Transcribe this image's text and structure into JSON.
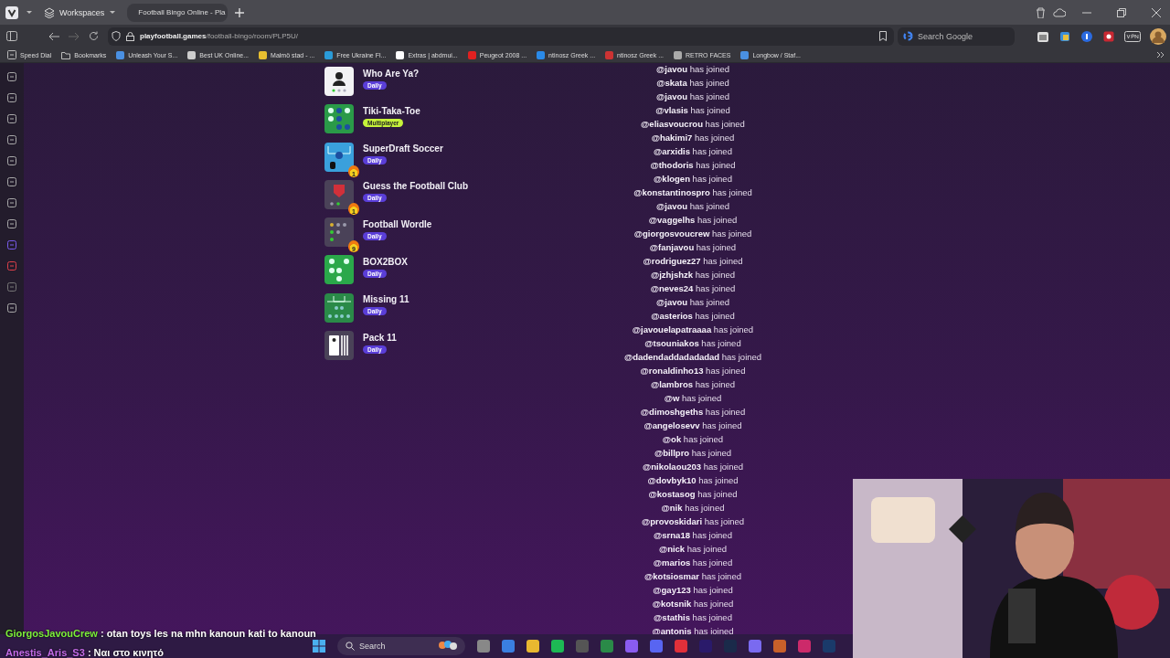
{
  "browser": {
    "workspaces": {
      "label": "Workspaces"
    },
    "tabs": [
      {
        "label": "Football Bingo Online - Pla",
        "selected": true
      }
    ],
    "url": {
      "host": "playfootball.games",
      "path": "/football-bingo/room/PLP5U/"
    },
    "search": {
      "placeholder": "Search Google"
    },
    "bookmarks": [
      {
        "label": "Speed Dial",
        "kind": "dial"
      },
      {
        "label": "Bookmarks",
        "kind": "folder"
      },
      {
        "label": "Unleash Your S...",
        "kind": "site"
      },
      {
        "label": "Best UK Online...",
        "kind": "site"
      },
      {
        "label": "Malmö stad - ...",
        "kind": "site"
      },
      {
        "label": "Free Ukraine Fl...",
        "kind": "site"
      },
      {
        "label": "Extras | abdmui...",
        "kind": "site"
      },
      {
        "label": "Peugeot 2008 ...",
        "kind": "site"
      },
      {
        "label": "ntinosz Greek ...",
        "kind": "site"
      },
      {
        "label": "ntinosz Greek ...",
        "kind": "site"
      },
      {
        "label": "RETRO FACES",
        "kind": "site"
      },
      {
        "label": "Longbow / Staf...",
        "kind": "site"
      }
    ]
  },
  "games": [
    {
      "title": "Who Are Ya?",
      "badge": {
        "label": "Daily",
        "kind": "daily"
      },
      "kind": "player"
    },
    {
      "title": "Tiki-Taka-Toe",
      "badge": {
        "label": "Multiplayer",
        "kind": "multiplayer"
      },
      "kind": "grid"
    },
    {
      "title": "SuperDraft Soccer",
      "badge": {
        "label": "Daily",
        "kind": "daily"
      },
      "kind": "pitch",
      "streak": "1"
    },
    {
      "title": "Guess the Football Club",
      "badge": {
        "label": "Daily",
        "kind": "daily"
      },
      "kind": "crest",
      "streak": "1"
    },
    {
      "title": "Football Wordle",
      "badge": {
        "label": "Daily",
        "kind": "daily"
      },
      "kind": "dots",
      "streak": "9"
    },
    {
      "title": "BOX2BOX",
      "badge": {
        "label": "Daily",
        "kind": "daily"
      },
      "kind": "dice"
    },
    {
      "title": "Missing 11",
      "badge": {
        "label": "Daily",
        "kind": "daily"
      },
      "kind": "lineup"
    },
    {
      "title": "Pack 11",
      "badge": {
        "label": "Daily",
        "kind": "daily"
      },
      "kind": "pack"
    }
  ],
  "joined": [
    {
      "user": "@javou",
      "text": "has joined"
    },
    {
      "user": "@skata",
      "text": "has joined"
    },
    {
      "user": "@javou",
      "text": "has joined"
    },
    {
      "user": "@vlasis",
      "text": "has joined"
    },
    {
      "user": "@eliasvoucrou",
      "text": "has joined"
    },
    {
      "user": "@hakimi7",
      "text": "has joined"
    },
    {
      "user": "@arxidis",
      "text": "has joined"
    },
    {
      "user": "@thodoris",
      "text": "has joined"
    },
    {
      "user": "@klogen",
      "text": "has joined"
    },
    {
      "user": "@konstantinospro",
      "text": "has joined"
    },
    {
      "user": "@javou",
      "text": "has joined"
    },
    {
      "user": "@vaggelhs",
      "text": "has joined"
    },
    {
      "user": "@giorgosvoucrew",
      "text": "has joined"
    },
    {
      "user": "@fanjavou",
      "text": "has joined"
    },
    {
      "user": "@rodriguez27",
      "text": "has joined"
    },
    {
      "user": "@jzhjshzk",
      "text": "has joined"
    },
    {
      "user": "@neves24",
      "text": "has joined"
    },
    {
      "user": "@javou",
      "text": "has joined"
    },
    {
      "user": "@asterios",
      "text": "has joined"
    },
    {
      "user": "@javouelapatraaaa",
      "text": "has joined"
    },
    {
      "user": "@tsouniakos",
      "text": "has joined"
    },
    {
      "user": "@dadendaddadadadad",
      "text": "has joined"
    },
    {
      "user": "@ronaldinho13",
      "text": "has joined"
    },
    {
      "user": "@lambros",
      "text": "has joined"
    },
    {
      "user": "@w",
      "text": "has joined"
    },
    {
      "user": "@dimoshgeths",
      "text": "has joined"
    },
    {
      "user": "@angelosevv",
      "text": "has joined"
    },
    {
      "user": "@ok",
      "text": "has joined"
    },
    {
      "user": "@billpro",
      "text": "has joined"
    },
    {
      "user": "@nikolaou203",
      "text": "has joined"
    },
    {
      "user": "@dovbyk10",
      "text": "has joined"
    },
    {
      "user": "@kostasog",
      "text": "has joined"
    },
    {
      "user": "@nik",
      "text": "has joined"
    },
    {
      "user": "@provoskidari",
      "text": "has joined"
    },
    {
      "user": "@srna18",
      "text": "has joined"
    },
    {
      "user": "@nick",
      "text": "has joined"
    },
    {
      "user": "@marios",
      "text": "has joined"
    },
    {
      "user": "@kotsiosmar",
      "text": "has joined"
    },
    {
      "user": "@gay123",
      "text": "has joined"
    },
    {
      "user": "@kotsnik",
      "text": "has joined"
    },
    {
      "user": "@stathis",
      "text": "has joined"
    },
    {
      "user": "@antonis",
      "text": "has joined"
    }
  ],
  "chat": [
    {
      "user": "GiorgosJavouCrew",
      "message": ": otan toys les na mhn kanoun kati to kanoun",
      "color": "#7cf03a"
    },
    {
      "user": "Anestis_Aris_S3",
      "message": ": Ναι στο κινητό",
      "color": "#c46be8"
    }
  ],
  "taskbar": {
    "search": {
      "placeholder": "Search"
    }
  }
}
